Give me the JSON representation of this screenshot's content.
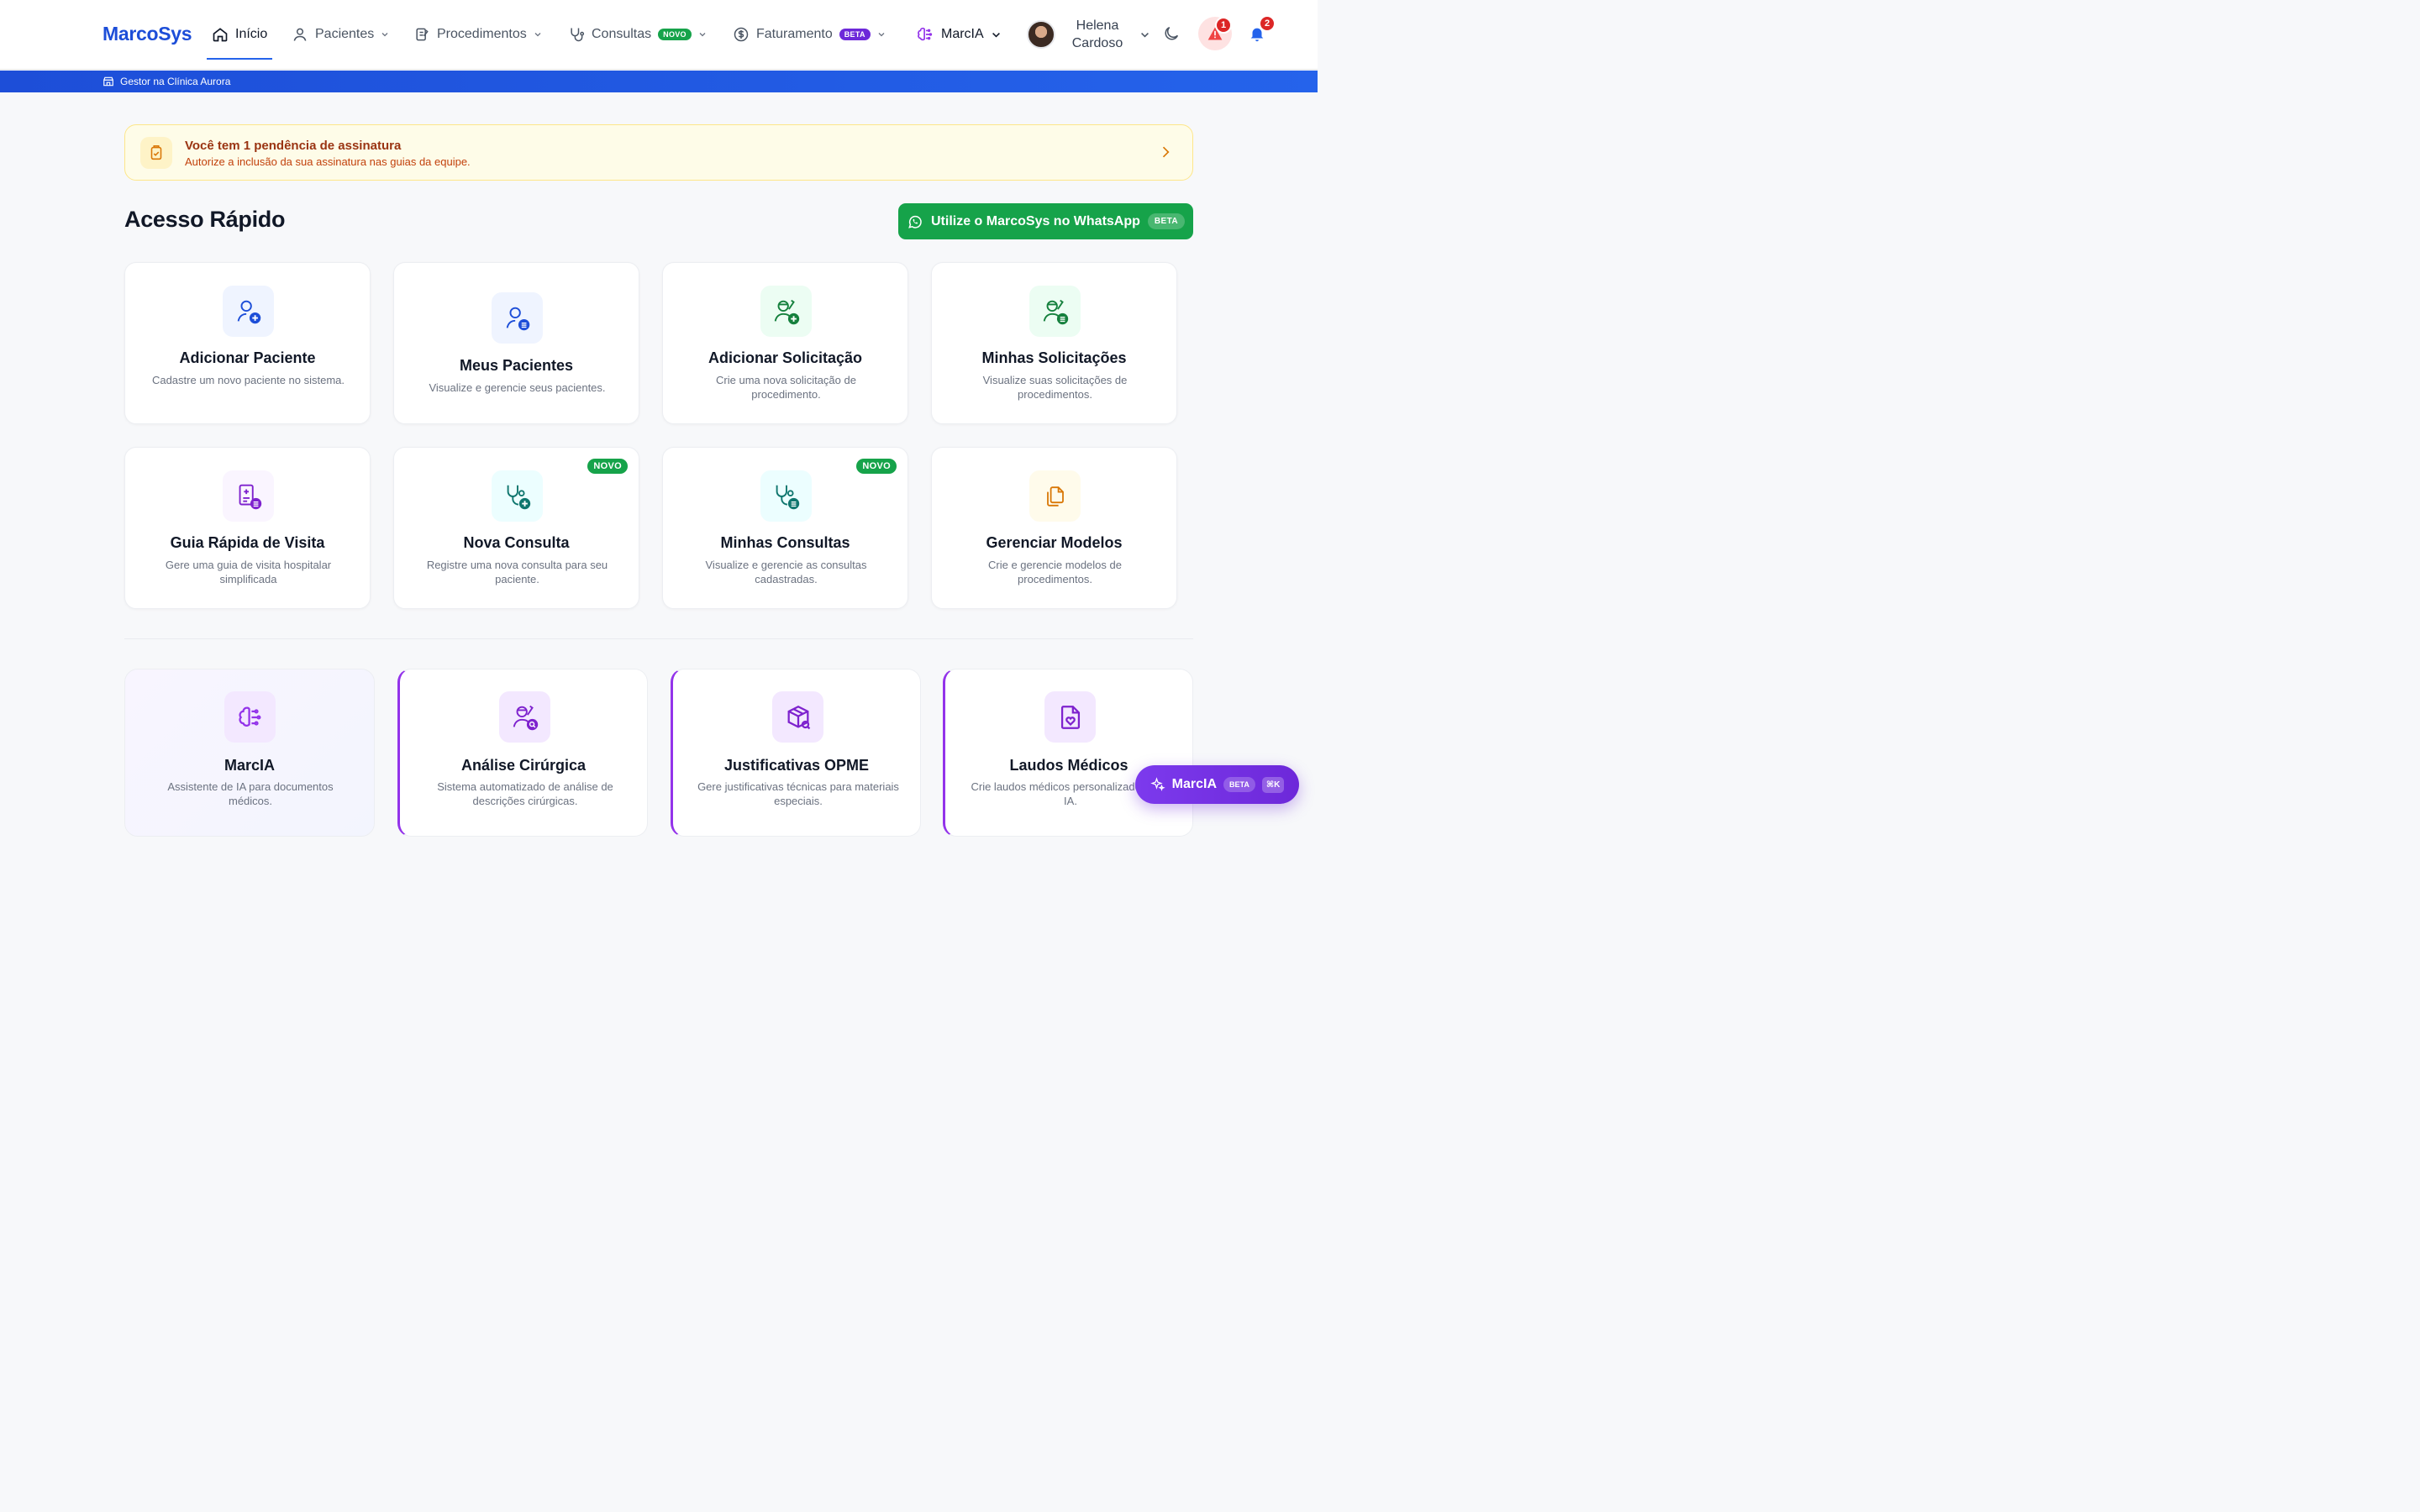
{
  "header": {
    "logo": "MarcoSys",
    "nav": {
      "inicio": "Início",
      "pacientes": "Pacientes",
      "procedimentos": "Procedimentos",
      "consultas": "Consultas",
      "consultas_badge": "NOVO",
      "faturamento": "Faturamento",
      "faturamento_badge": "BETA",
      "marcia": "MarcIA"
    },
    "user": {
      "first": "Helena",
      "last": "Cardoso"
    },
    "alerts_count": "1",
    "notifications_count": "2"
  },
  "clinic_bar": {
    "label": "Gestor na Clínica Aurora"
  },
  "alert": {
    "title": "Você tem 1 pendência de assinatura",
    "subtitle": "Autorize a inclusão da sua assinatura nas guias da equipe."
  },
  "quick_access": {
    "title": "Acesso Rápido",
    "whatsapp_label": "Utilize o MarcoSys no WhatsApp",
    "whatsapp_badge": "BETA",
    "cards": [
      {
        "title": "Adicionar Paciente",
        "desc": "Cadastre um novo paciente no sistema."
      },
      {
        "title": "Meus Pacientes",
        "desc": "Visualize e gerencie seus pacientes."
      },
      {
        "title": "Adicionar Solicitação",
        "desc": "Crie uma nova solicitação de procedimento."
      },
      {
        "title": "Minhas Solicitações",
        "desc": "Visualize suas solicitações de procedimentos."
      },
      {
        "title": "Guia Rápida de Visita",
        "desc": "Gere uma guia de visita hospitalar simplificada"
      },
      {
        "title": "Nova Consulta",
        "desc": "Registre uma nova consulta para seu paciente.",
        "badge": "NOVO"
      },
      {
        "title": "Minhas Consultas",
        "desc": "Visualize e gerencie as consultas cadastradas.",
        "badge": "NOVO"
      },
      {
        "title": "Gerenciar Modelos",
        "desc": "Crie e gerencie modelos de procedimentos."
      }
    ]
  },
  "ai_tools": [
    {
      "title": "MarcIA",
      "desc": "Assistente de IA para documentos médicos."
    },
    {
      "title": "Análise Cirúrgica",
      "desc": "Sistema automatizado de análise de descrições cirúrgicas."
    },
    {
      "title": "Justificativas OPME",
      "desc": "Gere justificativas técnicas para materiais especiais."
    },
    {
      "title": "Laudos Médicos",
      "desc": "Crie laudos médicos personalizados com IA."
    }
  ],
  "fab": {
    "label": "MarcIA",
    "badge": "BETA",
    "shortcut": "⌘K"
  },
  "colors": {
    "primary": "#1d4ed8",
    "success": "#16a34a",
    "purple": "#7c3aed",
    "warning": "#c2410c"
  }
}
